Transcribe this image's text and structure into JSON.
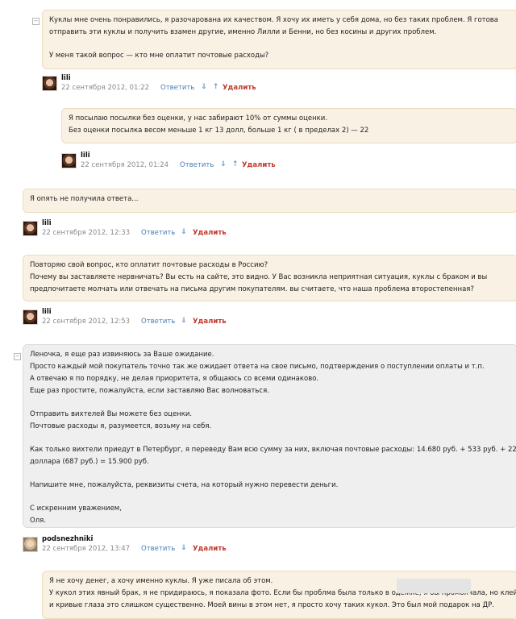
{
  "comments": [
    {
      "lines": [
        "Куклы мне очень понравились, я разочарована их качеством. Я хочу их иметь у себя дома, но без таких проблем. Я готова",
        "отправить эти куклы и получить взамен другие, именно Лилли и Бенни, но без косины и других проблем.",
        "",
        "У меня такой вопрос — кто мне оплатит почтовые расходы?"
      ],
      "author": "lili",
      "date": "22 сентября 2012, 01:22",
      "reply": "Ответить",
      "delete": "Удалить"
    },
    {
      "lines": [
        "Я посылаю посылки без оценки, у нас забирают 10% от суммы оценки.",
        "Без оценки посылка весом меньше 1 кг 13 долл, больше 1 кг ( в пределах 2) — 22"
      ],
      "author": "lili",
      "date": "22 сентября 2012, 01:24",
      "reply": "Ответить",
      "delete": "Удалить"
    },
    {
      "lines": [
        "Я опять не получила ответа..."
      ],
      "author": "lili",
      "date": "22 сентября 2012, 12:33",
      "reply": "Ответить",
      "delete": "Удалить"
    },
    {
      "lines": [
        "Повторяю свой вопрос, кто оплатит почтовые расходы в Россию?",
        "Почему вы заставляете нервничать? Вы есть на сайте, это видно. У Вас возникла неприятная ситуация, куклы с браком и вы",
        "предпочитаете молчать или отвечать на письма другим покупателям. вы считаете, что наша проблема второстепенная?"
      ],
      "author": "lili",
      "date": "22 сентября 2012, 12:53",
      "reply": "Ответить",
      "delete": "Удалить"
    },
    {
      "lines": [
        "Леночка, я еще раз извиняюсь за Ваше ожидание.",
        "Просто каждый мой покупатель точно так же ожидает ответа на свое письмо, подтверждения о поступлении оплаты и т.п.",
        "А отвечаю я по порядку, не делая приоритета, я общаюсь со всеми одинаково.",
        "Еще раз простите, пожалуйста, если заставляю Вас волноваться.",
        "",
        "Отправить вихтелей Вы можете без оценки.",
        "Почтовые расходы я, разумеется, возьму на себя.",
        "",
        "Как только вихтели приедут в Петербург, я переведу Вам всю сумму за них, включая почтовые расходы: 14.680 руб. + 533 руб. + 22",
        "доллара (687 руб.) = 15.900 руб.",
        "",
        "Напишите мне, пожалуйста, реквизиты счета, на который нужно перевести деньги.",
        "",
        "С искренним уважением,",
        "Оля."
      ],
      "author": "podsnezhniki",
      "date": "22 сентября 2012, 13:47",
      "reply": "Ответить",
      "delete": "Удалить"
    },
    {
      "lines": [
        "Я не хочу денег, а хочу именно куклы. Я уже писала об этом.",
        "У кукол этих явный брак, я не придираюсь, я показала фото. Если бы проблма была только в одежке, я бы промолчала, но клей",
        "и кривые глаза это слишком существенно. Моей вины в этом нет, я просто хочу таких кукол. Это был мой подарок на ДР."
      ]
    }
  ],
  "icons": {
    "collapse": "minus-icon",
    "down_arrow": "arrow-down-icon",
    "up_arrow": "arrow-up-icon"
  },
  "colors": {
    "owner_bubble": "#f9f1e3",
    "admin_bubble": "#efefef",
    "link": "#4a7fb5",
    "delete": "#c0392b"
  }
}
